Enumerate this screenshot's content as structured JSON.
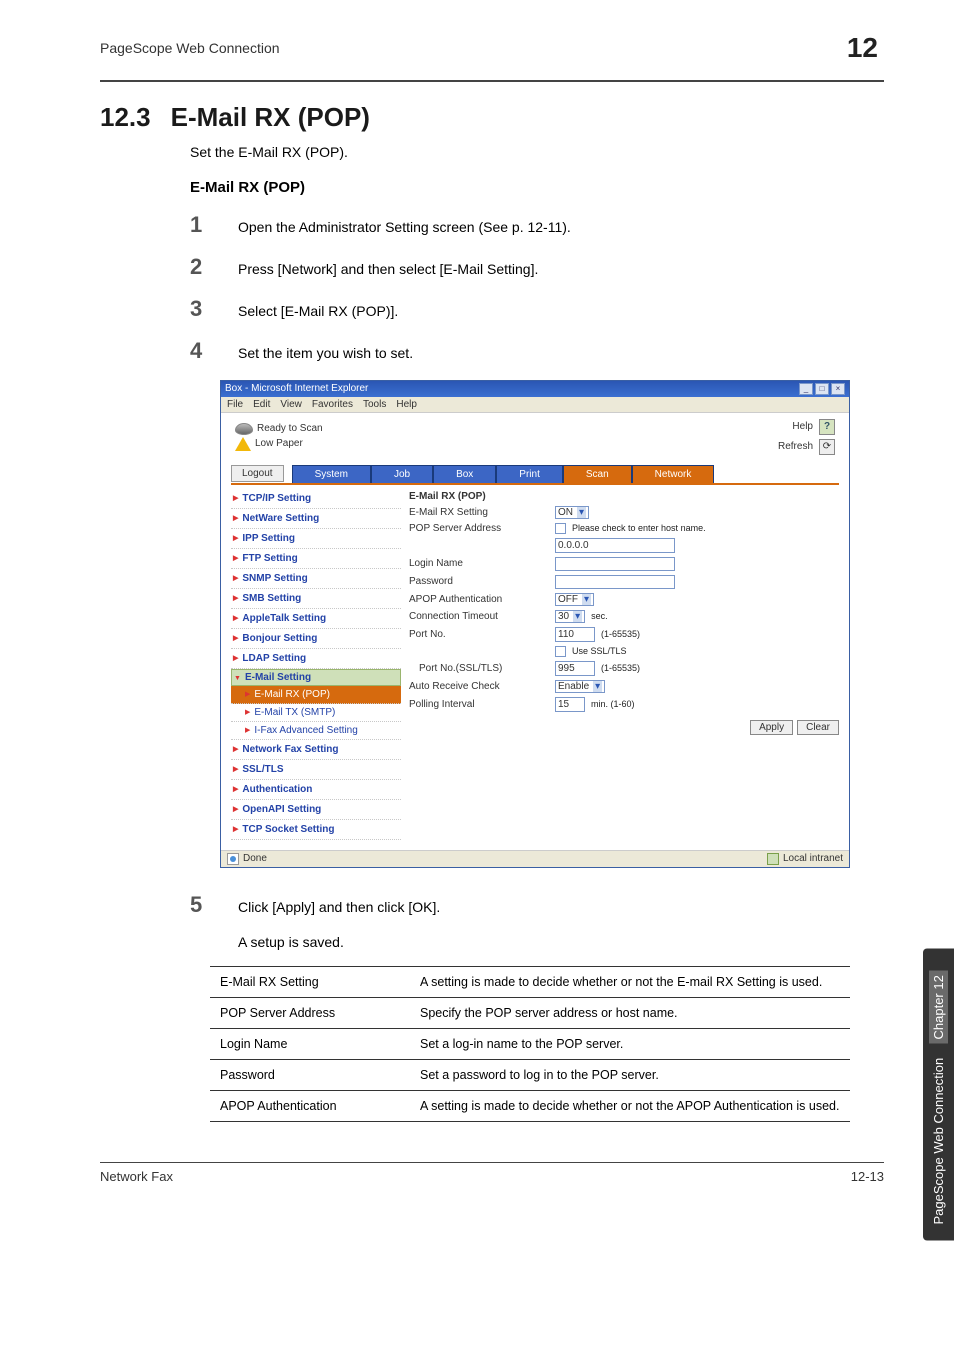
{
  "header": {
    "running_head": "PageScope Web Connection",
    "chapter_badge": "12"
  },
  "section": {
    "number": "12.3",
    "title": "E-Mail RX (POP)"
  },
  "intro": "Set the E-Mail RX (POP).",
  "subheading": "E-Mail RX (POP)",
  "steps": {
    "s1": {
      "n": "1",
      "t": "Open the Administrator Setting screen (See p. 12-11)."
    },
    "s2": {
      "n": "2",
      "t": "Press [Network] and then select [E-Mail Setting]."
    },
    "s3": {
      "n": "3",
      "t": "Select [E-Mail RX (POP)]."
    },
    "s4": {
      "n": "4",
      "t": "Set the item you wish to set."
    },
    "s5": {
      "n": "5",
      "t": "Click [Apply] and then click [OK]."
    }
  },
  "after5": "A setup is saved.",
  "browser": {
    "title": "Box - Microsoft Internet Explorer",
    "menus": {
      "file": "File",
      "edit": "Edit",
      "view": "View",
      "fav": "Favorites",
      "tools": "Tools",
      "help": "Help"
    },
    "top": {
      "ready": "Ready to Scan",
      "lowpaper": "Low Paper",
      "help": "Help",
      "refresh": "Refresh"
    },
    "logout": "Logout",
    "tabs": {
      "system": "System",
      "job": "Job",
      "box": "Box",
      "print": "Print",
      "scan": "Scan",
      "network": "Network"
    },
    "side": {
      "tcpip": "TCP/IP Setting",
      "netware": "NetWare Setting",
      "ipp": "IPP Setting",
      "ftp": "FTP Setting",
      "snmp": "SNMP Setting",
      "smb": "SMB Setting",
      "apple": "AppleTalk Setting",
      "bonjour": "Bonjour Setting",
      "ldap": "LDAP Setting",
      "email": "E-Mail Setting",
      "emailrx": "E-Mail RX (POP)",
      "emailtx": "E-Mail TX (SMTP)",
      "ifax": "I-Fax Advanced Setting",
      "netfax": "Network Fax Setting",
      "ssl": "SSL/TLS",
      "auth": "Authentication",
      "openapi": "OpenAPI Setting",
      "tcpsock": "TCP Socket Setting"
    },
    "form": {
      "title": "E-Mail RX (POP)",
      "rx_setting_label": "E-Mail RX Setting",
      "rx_setting_value": "ON",
      "pop_label": "POP Server Address",
      "pop_note": "Please check to enter host name.",
      "pop_value": "0.0.0.0",
      "login_label": "Login Name",
      "login_value": "",
      "pass_label": "Password",
      "pass_value": "",
      "apop_label": "APOP Authentication",
      "apop_value": "OFF",
      "conn_label": "Connection Timeout",
      "conn_value": "30",
      "conn_unit": "sec.",
      "port_label": "Port No.",
      "port_value": "110",
      "port_range": "(1-65535)",
      "usessl_label": "Use SSL/TLS",
      "sslport_label": "Port No.(SSL/TLS)",
      "sslport_value": "995",
      "sslport_range": "(1-65535)",
      "auto_label": "Auto Receive Check",
      "auto_value": "Enable",
      "poll_label": "Polling Interval",
      "poll_value": "15",
      "poll_unit": "min. (1-60)",
      "apply": "Apply",
      "clear": "Clear"
    },
    "status": {
      "done": "Done",
      "zone": "Local intranet"
    }
  },
  "table": {
    "r1": {
      "k": "E-Mail RX Setting",
      "v": "A setting is made to decide whether or not the E-mail RX Setting is used."
    },
    "r2": {
      "k": "POP Server Address",
      "v": "Specify the POP server address or host name."
    },
    "r3": {
      "k": "Login Name",
      "v": "Set a log-in name to the POP server."
    },
    "r4": {
      "k": "Password",
      "v": "Set a password to log in to the POP server."
    },
    "r5": {
      "k": "APOP Authentication",
      "v": "A setting is made to decide whether or not the APOP Authentication is used."
    }
  },
  "sidetab": {
    "label": "PageScope Web Connection",
    "chapter": "Chapter 12"
  },
  "footer": {
    "left": "Network Fax",
    "right": "12-13"
  }
}
